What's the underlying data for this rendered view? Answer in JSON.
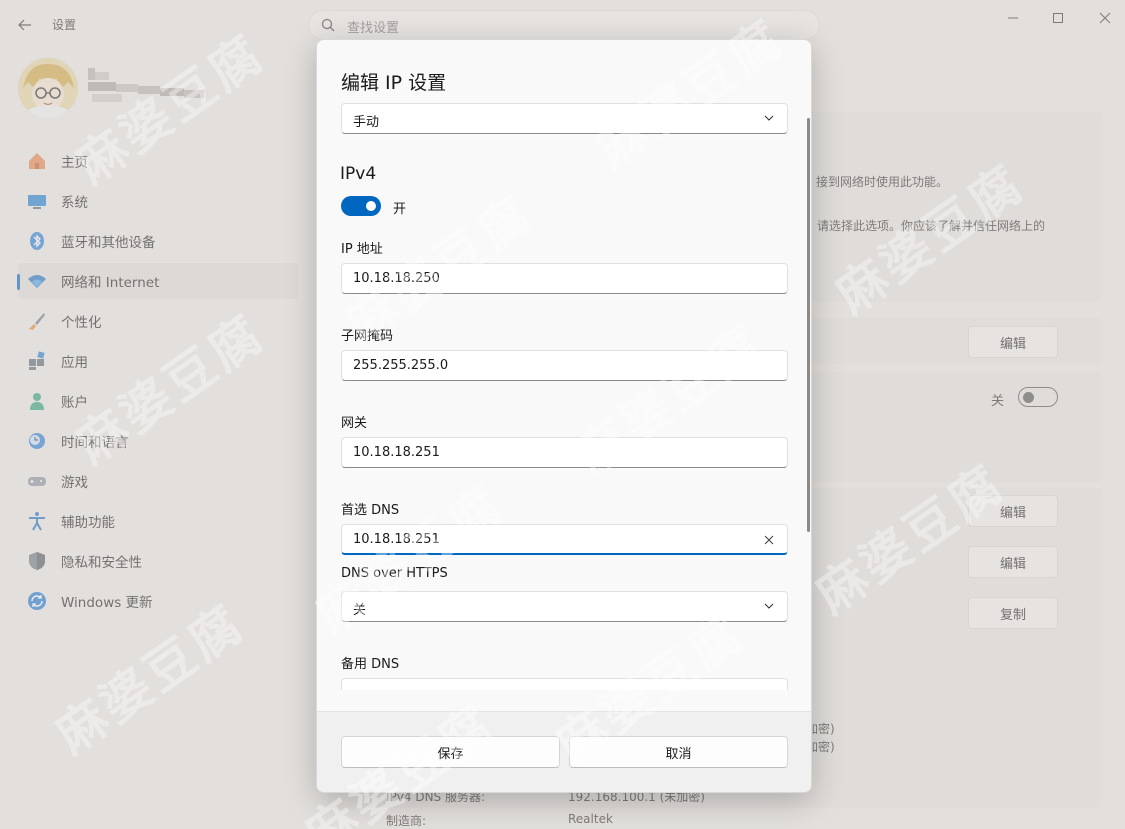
{
  "window": {
    "title": "设置",
    "search_placeholder": "查找设置"
  },
  "sidebar": {
    "items": [
      {
        "label": "主页",
        "icon": "home-icon"
      },
      {
        "label": "系统",
        "icon": "system-icon"
      },
      {
        "label": "蓝牙和其他设备",
        "icon": "bluetooth-icon"
      },
      {
        "label": "网络和 Internet",
        "icon": "wifi-icon",
        "active": true
      },
      {
        "label": "个性化",
        "icon": "brush-icon"
      },
      {
        "label": "应用",
        "icon": "apps-icon"
      },
      {
        "label": "账户",
        "icon": "account-icon"
      },
      {
        "label": "时间和语言",
        "icon": "time-language-icon"
      },
      {
        "label": "游戏",
        "icon": "gamepad-icon"
      },
      {
        "label": "辅助功能",
        "icon": "accessibility-icon"
      },
      {
        "label": "隐私和安全性",
        "icon": "shield-icon"
      },
      {
        "label": "Windows 更新",
        "icon": "update-icon"
      }
    ]
  },
  "background": {
    "text1": "接到网络时使用此功能。",
    "text2": "，请选择此选项。你应该了解并信任网络上的",
    "edit_label": "编辑",
    "copy_label": "复制",
    "toggle_off_label": "关",
    "enc1": "加密)",
    "enc2": "加密)",
    "dns_label": "IPv4 DNS 服务器:",
    "dns_value": "192.168.100.1 (未加密)",
    "manufacturer_label": "制造商:",
    "manufacturer_value": "Realtek"
  },
  "dialog": {
    "title": "编辑 IP 设置",
    "mode": "手动",
    "ipv4_heading": "IPv4",
    "ipv4_toggle": "开",
    "ip_label": "IP 地址",
    "ip_value": "10.18.18.250",
    "subnet_label": "子网掩码",
    "subnet_value": "255.255.255.0",
    "gateway_label": "网关",
    "gateway_value": "10.18.18.251",
    "dns_label": "首选 DNS",
    "dns_value": "10.18.18.251",
    "doh_label": "DNS over HTTPS",
    "doh_value": "关",
    "alt_dns_label": "备用 DNS",
    "save_label": "保存",
    "cancel_label": "取消"
  },
  "watermark": "麻婆豆腐",
  "colors": {
    "accent": "#0067c0"
  }
}
